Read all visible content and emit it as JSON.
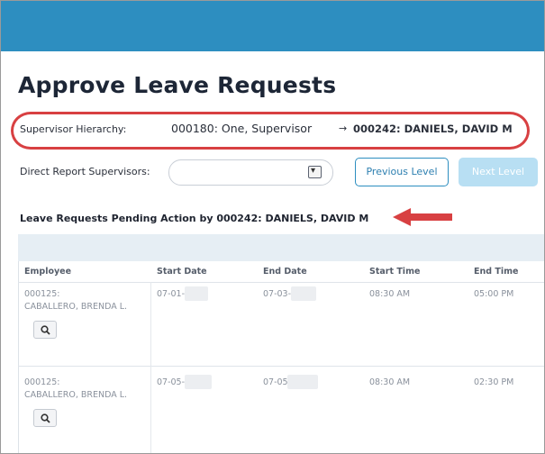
{
  "page_title": "Approve Leave Requests",
  "supervisor_hierarchy": {
    "label": "Supervisor Hierarchy:",
    "primary": "000180: One, Supervisor",
    "arrow": "→",
    "secondary": "000242: DANIELS, DAVID M"
  },
  "direct_report": {
    "label": "Direct Report Supervisors:",
    "selected": ""
  },
  "buttons": {
    "previous_level": "Previous Level",
    "next_level": "Next Level"
  },
  "pending_heading": "Leave Requests Pending Action by 000242: DANIELS, DAVID M",
  "table": {
    "columns": [
      "Employee",
      "Start Date",
      "End Date",
      "Start Time",
      "End Time"
    ],
    "rows": [
      {
        "employee_id": "000125:",
        "employee_name": "CABALLERO, BRENDA L.",
        "start_date": "07-01-",
        "end_date": "07-03-",
        "start_time": "08:30 AM",
        "end_time": "05:00 PM"
      },
      {
        "employee_id": "000125:",
        "employee_name": "CABALLERO, BRENDA L.",
        "start_date": "07-05-",
        "end_date": "07-05",
        "start_time": "08:30 AM",
        "end_time": "02:30 PM"
      }
    ]
  },
  "colors": {
    "header_bar": "#2d8ec0",
    "annotation_red": "#d84042",
    "button_outline": "#2d8ec0",
    "disabled_button": "#b8dff3"
  },
  "icons": [
    "search-icon",
    "chevron-down-icon",
    "arrow-right-icon"
  ]
}
